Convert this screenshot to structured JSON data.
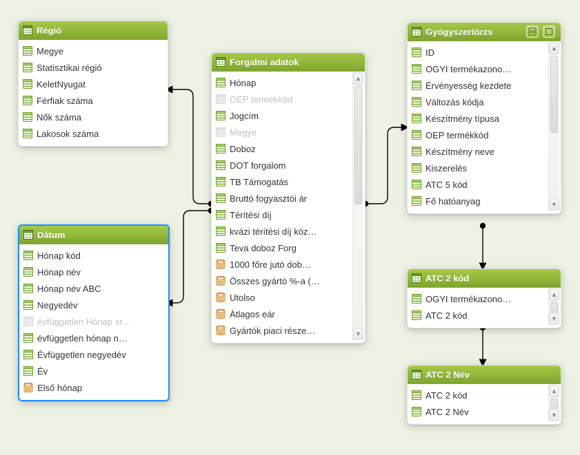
{
  "tables": {
    "regio": {
      "title": "Régió",
      "fields": [
        {
          "label": "Megye",
          "icon": "column"
        },
        {
          "label": "Statisztikai régió",
          "icon": "column"
        },
        {
          "label": "KeletNyugat",
          "icon": "column"
        },
        {
          "label": "Férfiak száma",
          "icon": "column"
        },
        {
          "label": "Nők száma",
          "icon": "column"
        },
        {
          "label": "Lakosok száma",
          "icon": "column"
        }
      ]
    },
    "datum": {
      "title": "Dátum",
      "fields": [
        {
          "label": "Hónap kód",
          "icon": "column"
        },
        {
          "label": "Hónap név",
          "icon": "column"
        },
        {
          "label": "Hónap név ABC",
          "icon": "column"
        },
        {
          "label": "Negyedév",
          "icon": "column"
        },
        {
          "label": "évfüggetlen Hónap sr…",
          "icon": "column",
          "disabled": true
        },
        {
          "label": "évfüggetlen hónap n…",
          "icon": "column"
        },
        {
          "label": "Évfüggetlen negyedév",
          "icon": "column"
        },
        {
          "label": "Év",
          "icon": "column"
        },
        {
          "label": "Első hónap",
          "icon": "calc"
        }
      ]
    },
    "forgalmi": {
      "title": "Forgalmi adatok",
      "fields": [
        {
          "label": "Hónap",
          "icon": "column"
        },
        {
          "label": "OEP termékkód",
          "icon": "column",
          "disabled": true
        },
        {
          "label": "Jogcím",
          "icon": "column"
        },
        {
          "label": "Megye",
          "icon": "column",
          "disabled": true
        },
        {
          "label": "Doboz",
          "icon": "column"
        },
        {
          "label": "DOT forgalom",
          "icon": "column"
        },
        {
          "label": "TB Támogatás",
          "icon": "column"
        },
        {
          "label": "Bruttó fogyasztói ár",
          "icon": "column"
        },
        {
          "label": "Térítési díj",
          "icon": "column"
        },
        {
          "label": "kvázi térítési díj köz…",
          "icon": "column"
        },
        {
          "label": "Teva doboz Forg",
          "icon": "column"
        },
        {
          "label": "1000 főre jutó dob…",
          "icon": "calc"
        },
        {
          "label": "Összes gyártó %-a (…",
          "icon": "calc"
        },
        {
          "label": "Utolso",
          "icon": "calc"
        },
        {
          "label": "Átlagos eár",
          "icon": "calc"
        },
        {
          "label": "Gyártók piaci része…",
          "icon": "calc"
        }
      ]
    },
    "gyogy": {
      "title": "Gyógyszertörzs",
      "fields": [
        {
          "label": "ID",
          "icon": "column"
        },
        {
          "label": "OGYI termékazono…",
          "icon": "column"
        },
        {
          "label": "Érvényesség kezdete",
          "icon": "column"
        },
        {
          "label": "Változás kódja",
          "icon": "column"
        },
        {
          "label": "Készítmény típusa",
          "icon": "column"
        },
        {
          "label": "OEP termékkód",
          "icon": "column"
        },
        {
          "label": "Készítmény neve",
          "icon": "column"
        },
        {
          "label": "Kiszerelés",
          "icon": "column"
        },
        {
          "label": "ATC 5 kód",
          "icon": "column"
        },
        {
          "label": "Fő hatóanyag",
          "icon": "column"
        }
      ]
    },
    "atc2kod": {
      "title": "ATC 2 kód",
      "fields": [
        {
          "label": "OGYI termékazono…",
          "icon": "column"
        },
        {
          "label": "ATC 2 kód",
          "icon": "column"
        }
      ]
    },
    "atc2nev": {
      "title": "ATC 2 Név",
      "fields": [
        {
          "label": "ATC 2 kód",
          "icon": "column"
        },
        {
          "label": "ATC 2 Név",
          "icon": "column"
        }
      ]
    }
  },
  "relations": [
    {
      "from": "forgalmi",
      "to": "regio"
    },
    {
      "from": "forgalmi",
      "to": "datum"
    },
    {
      "from": "forgalmi",
      "to": "gyogy"
    },
    {
      "from": "gyogy",
      "to": "atc2kod"
    },
    {
      "from": "atc2kod",
      "to": "atc2nev"
    }
  ],
  "colors": {
    "header_from": "#a7c84b",
    "header_to": "#7fa42e",
    "background": "#eef2e4",
    "selected_border": "#1e90ff"
  }
}
